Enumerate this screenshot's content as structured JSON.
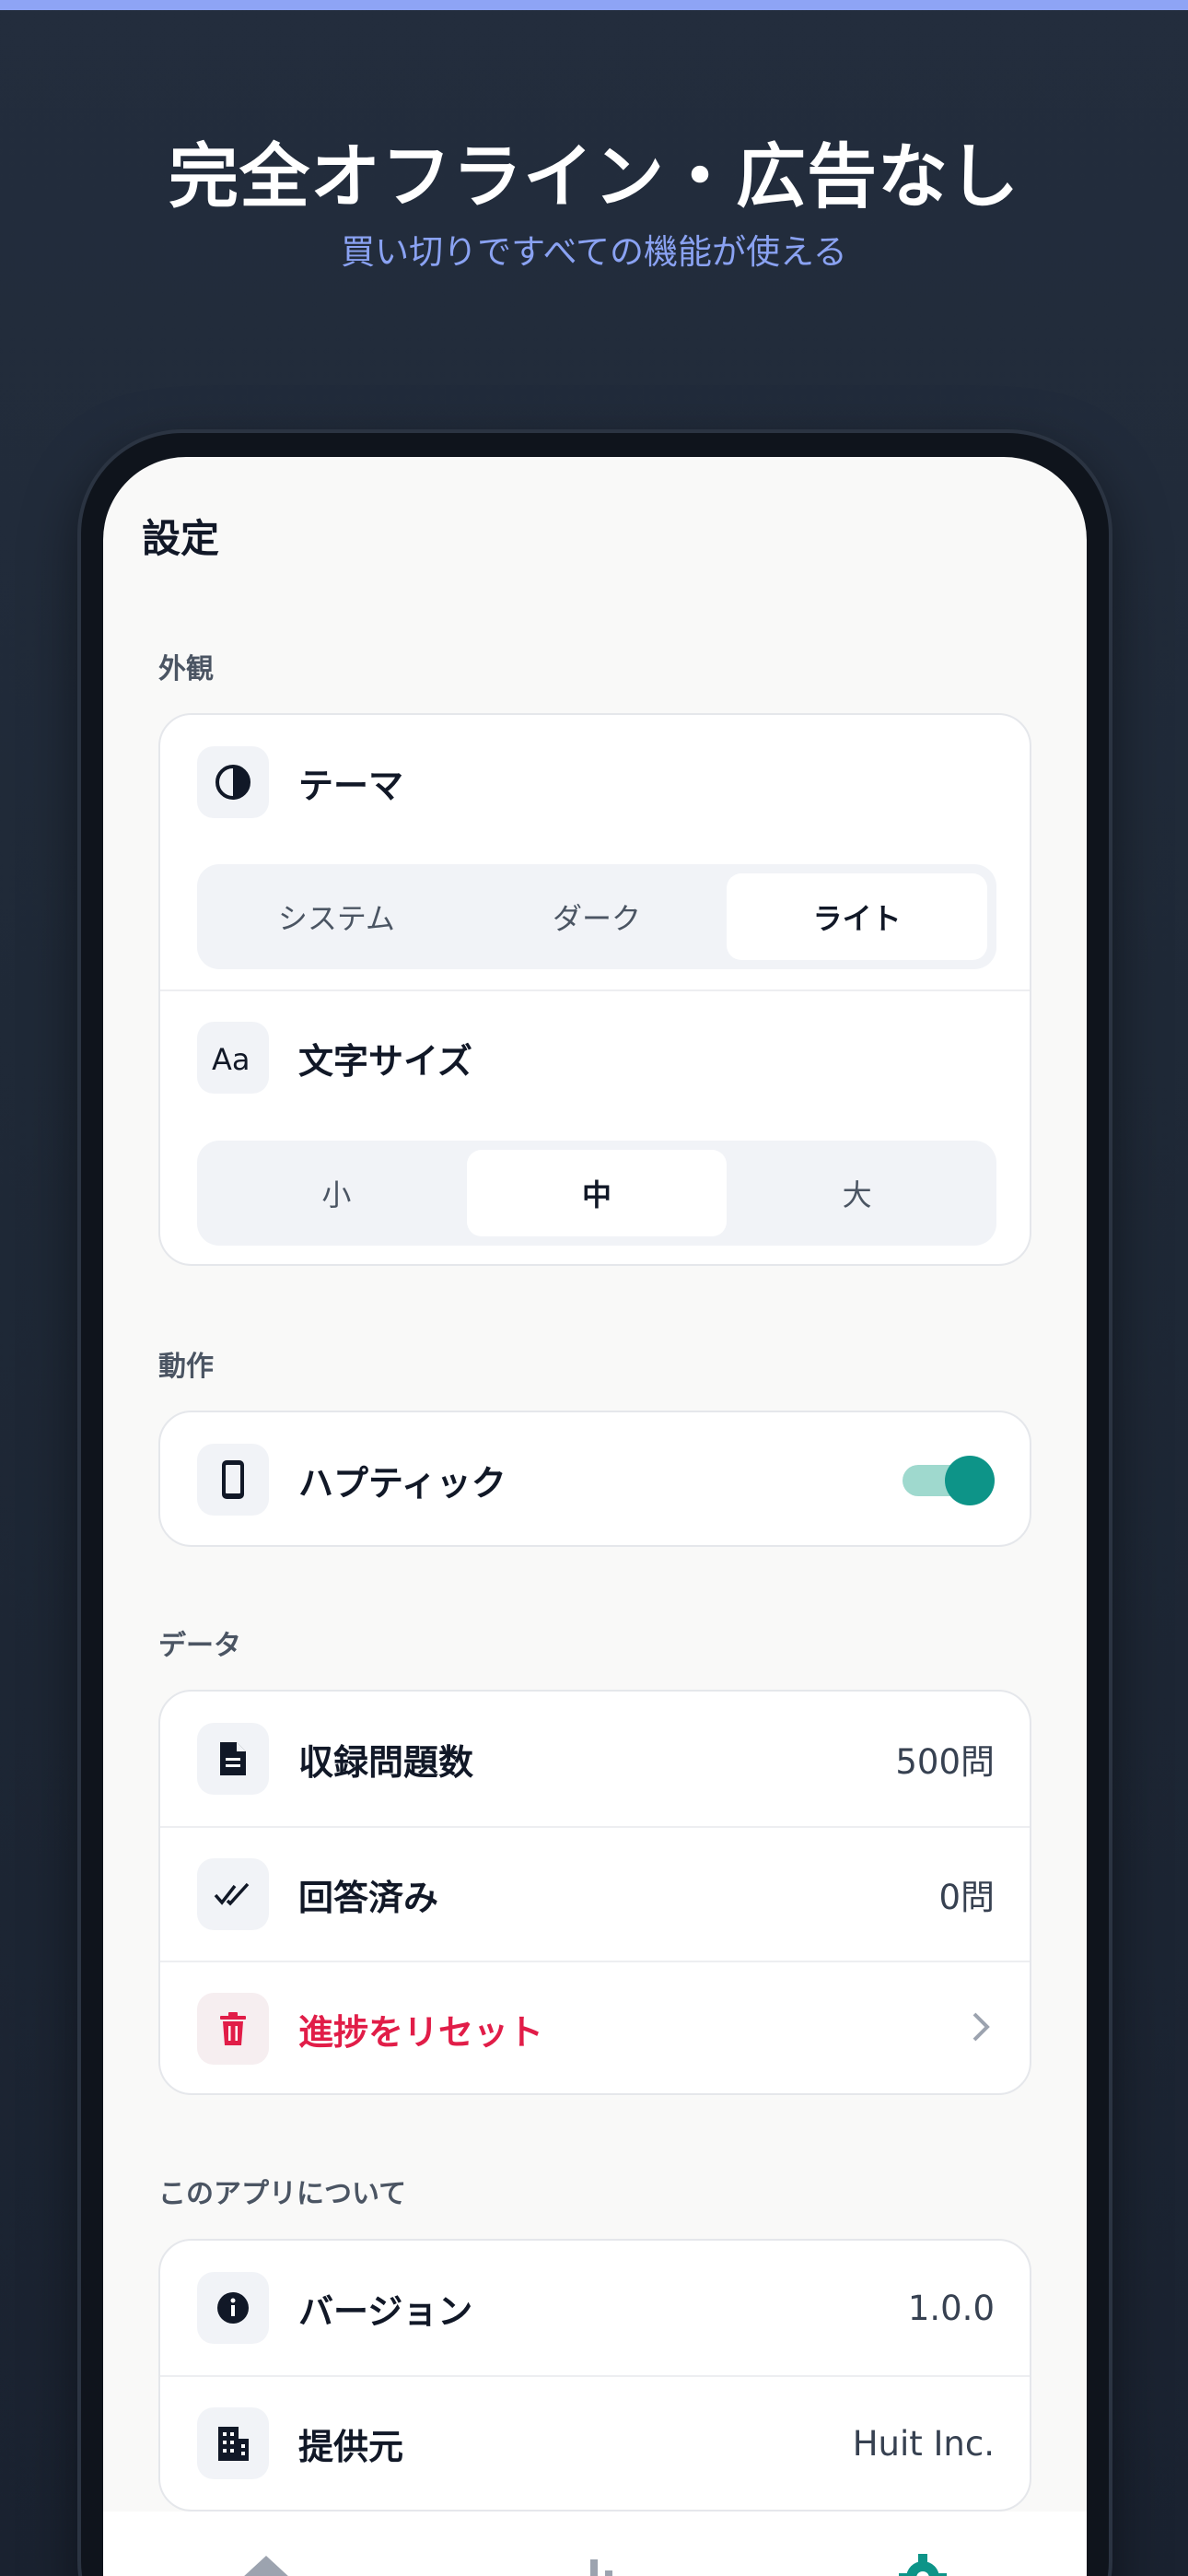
{
  "promo": {
    "headline": "完全オフライン・広告なし",
    "subline": "買い切りですべての機能が使える"
  },
  "settings": {
    "title": "設定",
    "appearance": {
      "section_label": "外観",
      "theme_label": "テーマ",
      "theme_options": [
        "システム",
        "ダーク",
        "ライト"
      ],
      "theme_selected": "ライト",
      "font_size_label": "文字サイズ",
      "font_size_options": [
        "小",
        "中",
        "大"
      ],
      "font_size_selected": "中"
    },
    "behavior": {
      "section_label": "動作",
      "haptic_label": "ハプティック",
      "haptic_on": true
    },
    "data": {
      "section_label": "データ",
      "question_count_label": "収録問題数",
      "question_count_value": "500問",
      "answered_label": "回答済み",
      "answered_value": "0問",
      "reset_label": "進捗をリセット"
    },
    "about": {
      "section_label": "このアプリについて",
      "version_label": "バージョン",
      "version_value": "1.0.0",
      "provider_label": "提供元",
      "provider_value": "Huit Inc."
    }
  },
  "tabbar": {
    "icons": [
      "home-icon",
      "stats-icon",
      "settings-icon"
    ],
    "active": "settings-icon"
  },
  "colors": {
    "accent": "#0d9488",
    "danger": "#e11d48",
    "subline": "#8aa2f2"
  }
}
